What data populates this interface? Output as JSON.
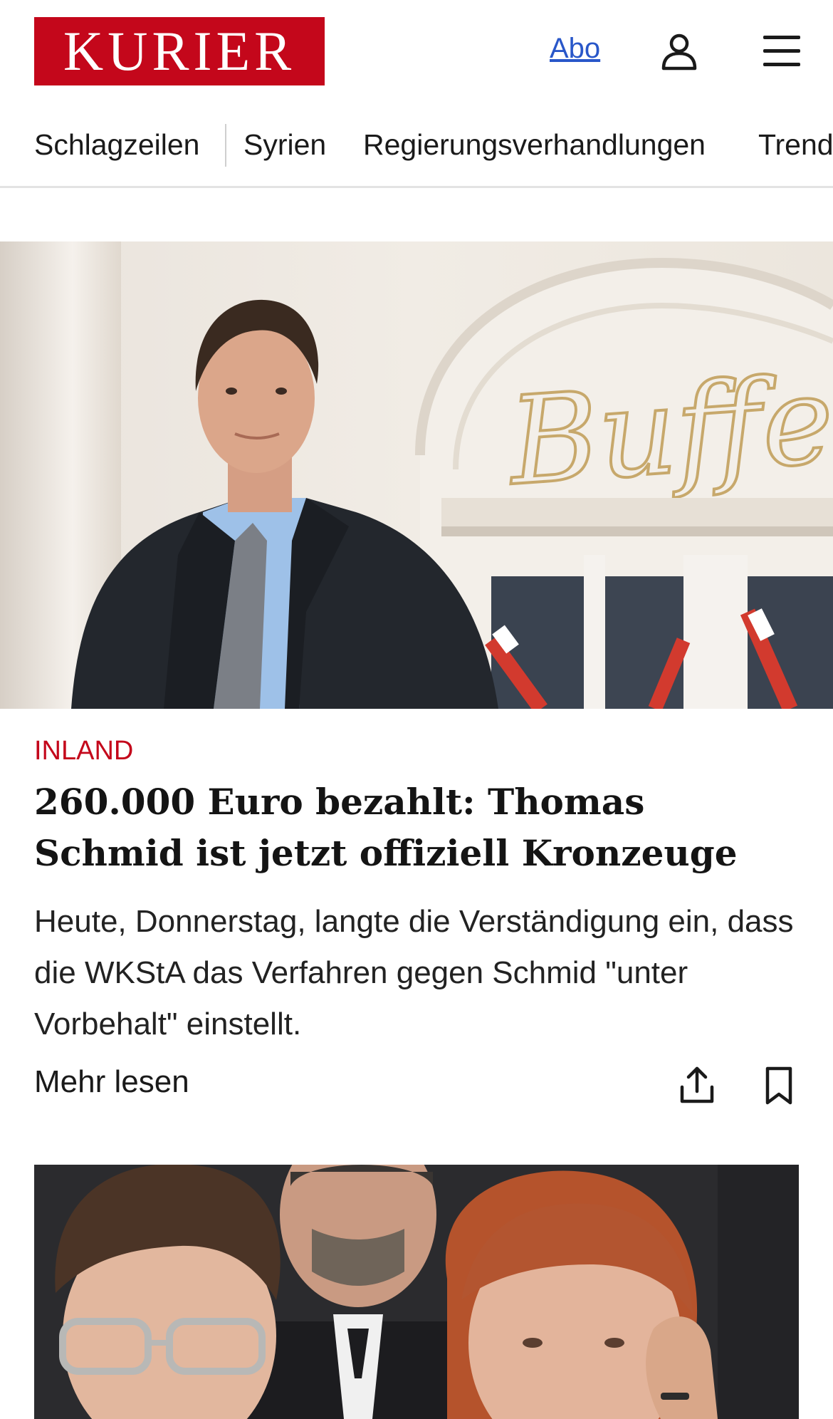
{
  "header": {
    "logo_text": "KURIER",
    "abo_label": "Abo",
    "account_icon": "account-icon",
    "menu_icon": "menu-icon",
    "brand_color": "#c4071b",
    "link_color": "#2957c9"
  },
  "nav": {
    "items": [
      "Schlagzeilen",
      "Syrien",
      "Regierungsverhandlungen",
      "Trend"
    ]
  },
  "article": {
    "category": "INLAND",
    "headline": "260.000 Euro bezahlt: Thomas Schmid ist jetzt offiziell Kronzeuge",
    "teaser": "Heute, Donnerstag, langte die Verständigung ein, dass die WKStA das Verfahren gegen Schmid \"unter Vorbehalt\" einstellt.",
    "readmore_label": "Mehr lesen",
    "image_sign_text": "Buffet",
    "share_icon": "share-icon",
    "bookmark_icon": "bookmark-icon"
  }
}
